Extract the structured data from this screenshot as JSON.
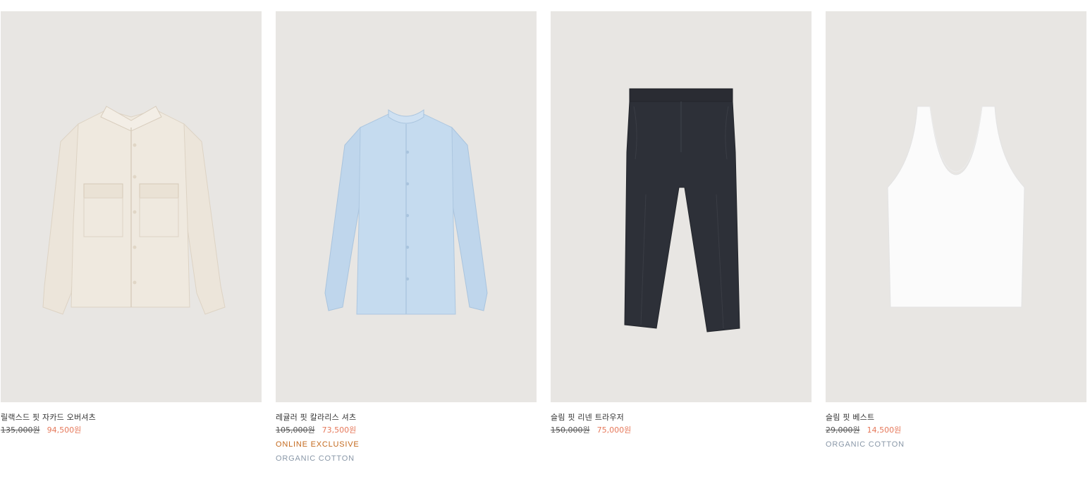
{
  "products": [
    {
      "name": "릴랙스드 핏 자카드 오버셔츠",
      "original_price": "135,000원",
      "sale_price": "94,500원",
      "tags": [],
      "garment": "cream jacquard overshirt",
      "colors": {
        "garment": "#efe9df"
      }
    },
    {
      "name": "레귤러 핏 칼라리스 셔츠",
      "original_price": "105,000원",
      "sale_price": "73,500원",
      "tags": [
        {
          "label": "ONLINE EXCLUSIVE",
          "kind": "online"
        },
        {
          "label": "ORGANIC COTTON",
          "kind": "organic"
        }
      ],
      "garment": "light blue collarless shirt",
      "colors": {
        "garment": "#c5dbef"
      }
    },
    {
      "name": "슬림 핏 리넨 트라우저",
      "original_price": "150,000원",
      "sale_price": "75,000원",
      "tags": [],
      "garment": "navy linen trousers",
      "colors": {
        "garment": "#2d3038"
      }
    },
    {
      "name": "슬림 핏 베스트",
      "original_price": "29,000원",
      "sale_price": "14,500원",
      "tags": [
        {
          "label": "ORGANIC COTTON",
          "kind": "organic"
        }
      ],
      "garment": "white vest",
      "colors": {
        "garment": "#fbfbfb"
      }
    }
  ],
  "colors": {
    "image_background": "#e8e6e3",
    "sale_price": "#e6785a",
    "online_exclusive": "#c46a1e",
    "organic_cotton": "#8a98a8"
  }
}
